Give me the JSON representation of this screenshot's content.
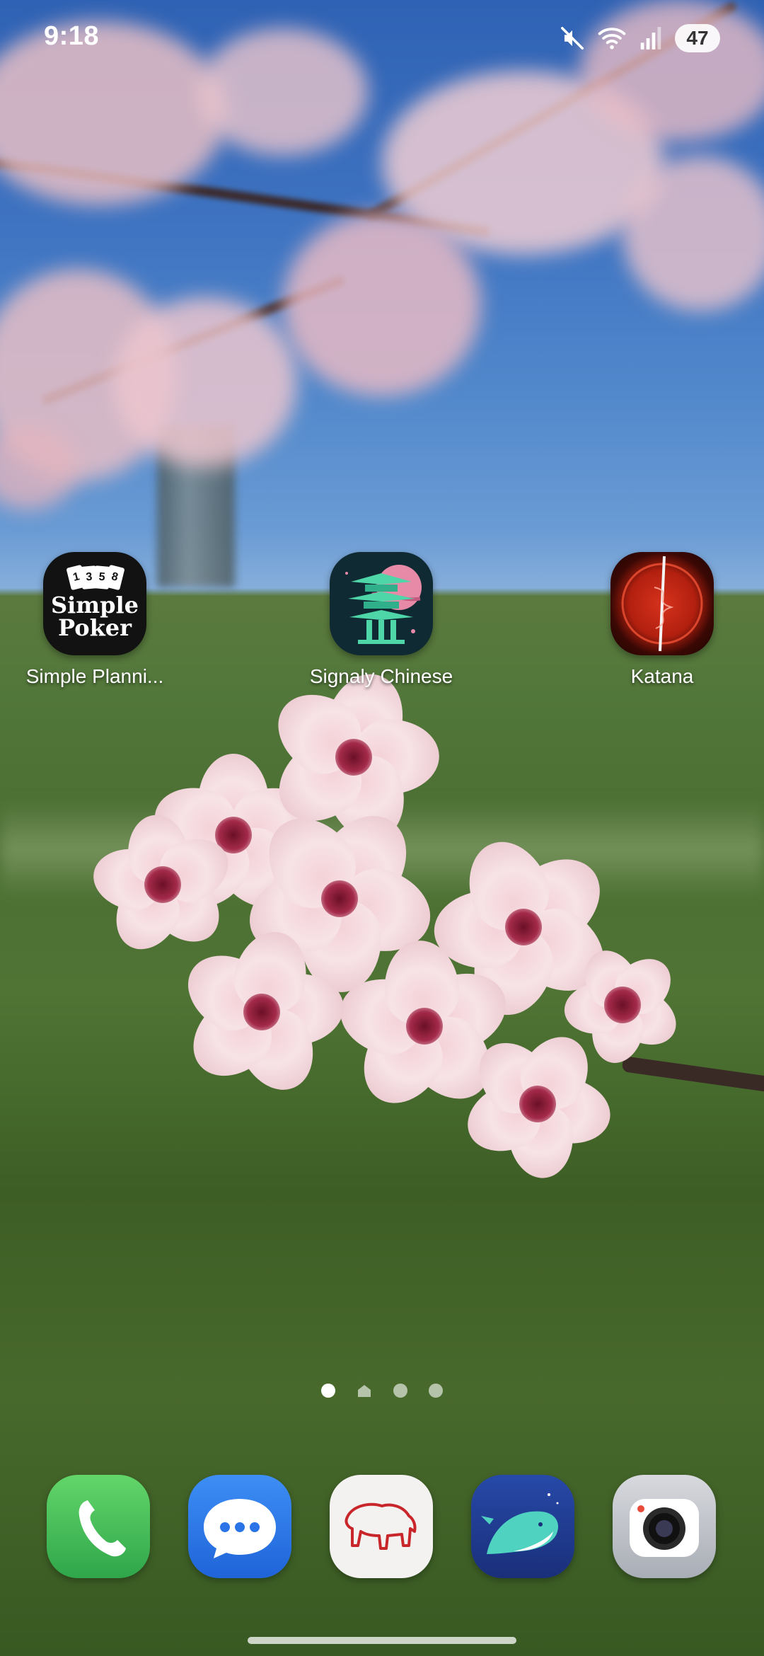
{
  "status_bar": {
    "time": "9:18",
    "battery": "47",
    "icons": [
      "mute-icon",
      "wifi-icon",
      "signal-icon"
    ]
  },
  "home_apps": [
    {
      "label": "Simple Planni...",
      "icon": "simple-poker-icon",
      "icon_lines": [
        "Simple",
        "Poker"
      ],
      "cards": [
        "1",
        "3",
        "5",
        "8"
      ]
    },
    {
      "label": "Signaly Chinese",
      "icon": "pagoda-icon"
    },
    {
      "label": "Katana",
      "icon": "katana-icon"
    }
  ],
  "page_indicator": {
    "pages": 4,
    "active": 0,
    "home_page": 1
  },
  "dock": [
    {
      "name": "Phone",
      "icon": "phone-icon"
    },
    {
      "name": "Messages",
      "icon": "messages-icon"
    },
    {
      "name": "Bison",
      "icon": "bison-icon"
    },
    {
      "name": "Whale",
      "icon": "whale-icon"
    },
    {
      "name": "Camera",
      "icon": "camera-icon"
    }
  ],
  "colors": {
    "sky": "#4a7fc8",
    "grass": "#4e7234",
    "blossom": "#f3d4da"
  }
}
